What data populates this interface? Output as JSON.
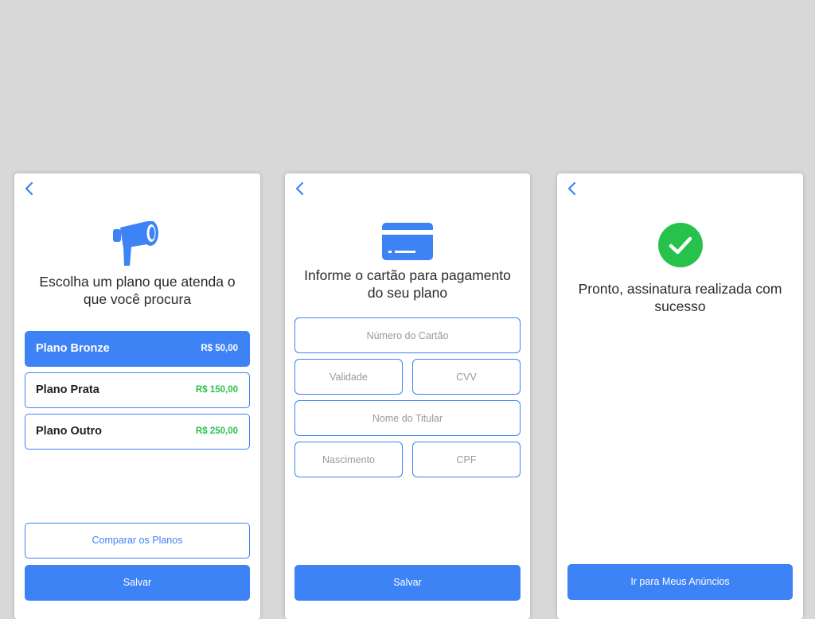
{
  "colors": {
    "accent": "#3e83f5",
    "price_green": "#27c24c",
    "success_green": "#27c24c",
    "background": "#d8d8d8"
  },
  "plans_screen": {
    "heading": "Escolha um plano que atenda o que você procura",
    "icon": "megaphone-icon",
    "plans": [
      {
        "name": "Plano Bronze",
        "price": "R$ 50,00",
        "selected": true
      },
      {
        "name": "Plano Prata",
        "price": "R$ 150,00",
        "selected": false
      },
      {
        "name": "Plano Outro",
        "price": "R$ 250,00",
        "selected": false
      }
    ],
    "compare_label": "Comparar os Planos",
    "save_label": "Salvar"
  },
  "payment_screen": {
    "heading": "Informe o cartão para pagamento do seu plano",
    "icon": "credit-card-icon",
    "fields": {
      "card_number": "Número do Cartão",
      "expiry": "Validade",
      "cvv": "CVV",
      "holder_name": "Nome do Titular",
      "birth_date": "Nascimento",
      "cpf": "CPF"
    },
    "save_label": "Salvar"
  },
  "success_screen": {
    "heading": "Pronto, assinatura realizada com sucesso",
    "icon": "check-circle-icon",
    "cta_label": "Ir para Meus Anúncios"
  }
}
